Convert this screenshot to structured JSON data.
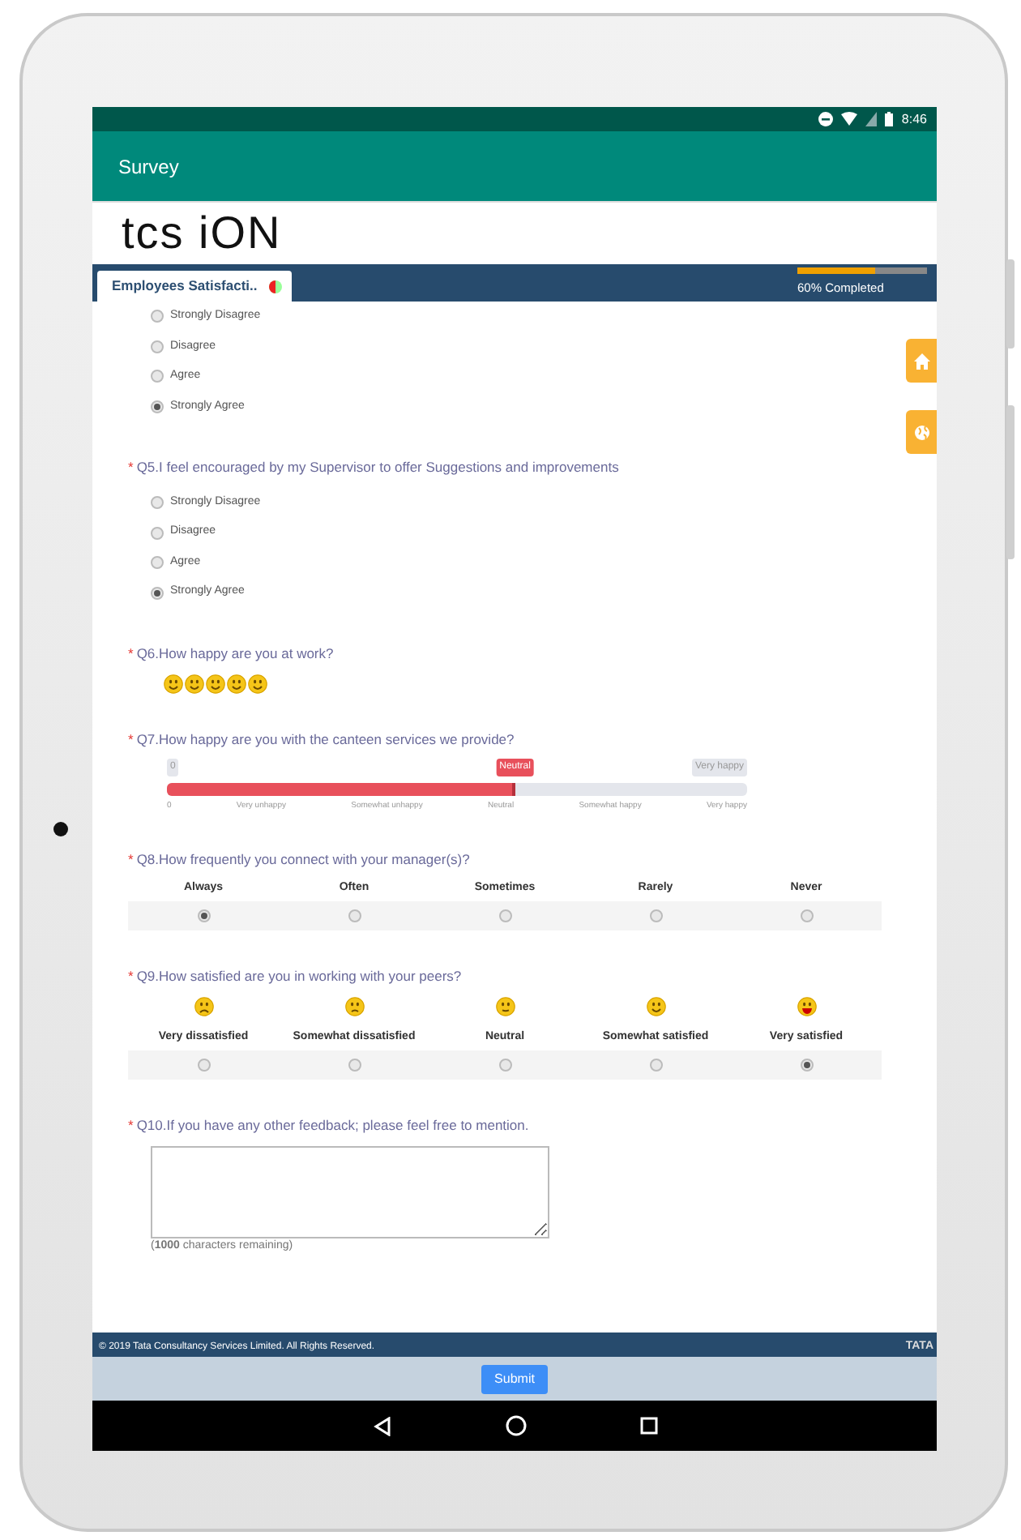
{
  "status_bar": {
    "time": "8:46"
  },
  "app_bar": {
    "title": "Survey"
  },
  "logo": {
    "text": "tcs iON"
  },
  "tab": {
    "label": "Employees Satisfacti..",
    "selected": true
  },
  "progress": {
    "level": 0.6,
    "label": "60% Completed"
  },
  "questions": [
    {
      "kind": "radio-list",
      "options": [
        {
          "label": "Strongly Disagree",
          "selected": false
        },
        {
          "label": "Disagree",
          "selected": false
        },
        {
          "label": "Agree",
          "selected": false
        },
        {
          "label": "Strongly Agree",
          "selected": true
        }
      ]
    },
    {
      "kind": "radio-list",
      "marker": "*",
      "title": "Q5.I feel encouraged by my Supervisor to offer Suggestions and improvements",
      "options": [
        {
          "label": "Strongly Disagree",
          "selected": false
        },
        {
          "label": "Disagree",
          "selected": false
        },
        {
          "label": "Agree",
          "selected": false
        },
        {
          "label": "Strongly Agree",
          "selected": true
        }
      ]
    },
    {
      "kind": "smileys",
      "marker": "*",
      "title": "Q6.How happy are you at work?",
      "stars": 5
    },
    {
      "kind": "slider",
      "marker": "*",
      "title": "Q7.How happy are you with the canteen services we provide?",
      "min_label": "0",
      "max_label": "Very happy",
      "value_label": "Neutral",
      "level": 0.6,
      "ticks": [
        "0",
        "Very unhappy",
        "Somewhat unhappy",
        "Neutral",
        "Somewhat happy",
        "Very happy"
      ]
    },
    {
      "kind": "matrix",
      "marker": "*",
      "title": "Q8.How frequently you connect with your manager(s)?",
      "columns": [
        {
          "label": "Always",
          "selected": true
        },
        {
          "label": "Often",
          "selected": false
        },
        {
          "label": "Sometimes",
          "selected": false
        },
        {
          "label": "Rarely",
          "selected": false
        },
        {
          "label": "Never",
          "selected": false
        }
      ]
    },
    {
      "kind": "matrix",
      "marker": "*",
      "title": "Q9.How satisfied are you in working with your peers?",
      "columns": [
        {
          "label": "Very dissatisfied",
          "kind": "frown",
          "selected": false
        },
        {
          "label": "Somewhat dissatisfied",
          "kind": "sad",
          "selected": false
        },
        {
          "label": "Neutral",
          "kind": "neutral",
          "selected": false
        },
        {
          "label": "Somewhat satisfied",
          "kind": "smile",
          "selected": false
        },
        {
          "label": "Very satisfied",
          "kind": "grin",
          "selected": true
        }
      ]
    },
    {
      "kind": "text",
      "marker": "*",
      "title": "Q10.If you have any other feedback; please feel free to mention.",
      "counter": "(**1000** characters remaining)"
    }
  ],
  "footer": {
    "copyright": "© 2019 Tata Consultancy Services Limited. All Rights Reserved.",
    "brand": "TATA"
  },
  "submit": {
    "label": "Submit"
  }
}
